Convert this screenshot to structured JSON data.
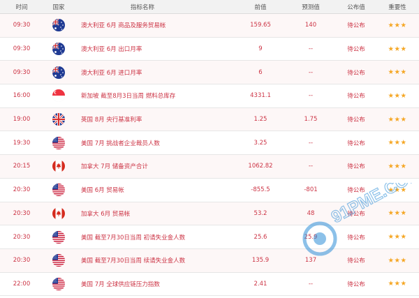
{
  "table": {
    "headers": {
      "time": "时间",
      "country": "国家",
      "indicator": "指标名称",
      "previous": "前值",
      "forecast": "预测值",
      "actual": "公布值",
      "importance": "重要性"
    },
    "rows": [
      {
        "time": "09:30",
        "flag": "australia-flag-icon",
        "indicator": "澳大利亚 6月 商品及服务贸易帐",
        "previous": "159.65",
        "forecast": "140",
        "actual": "待公布",
        "stars": "★★★"
      },
      {
        "time": "09:30",
        "flag": "australia-flag-icon",
        "indicator": "澳大利亚 6月 出口月率",
        "previous": "9",
        "forecast": "--",
        "actual": "待公布",
        "stars": "★★★"
      },
      {
        "time": "09:30",
        "flag": "australia-flag-icon",
        "indicator": "澳大利亚 6月 进口月率",
        "previous": "6",
        "forecast": "--",
        "actual": "待公布",
        "stars": "★★★"
      },
      {
        "time": "16:00",
        "flag": "singapore-flag-icon",
        "indicator": "新加坡 截至8月3日当周 燃料总库存",
        "previous": "4331.1",
        "forecast": "--",
        "actual": "待公布",
        "stars": "★★★"
      },
      {
        "time": "19:00",
        "flag": "uk-flag-icon",
        "indicator": "英国 8月 央行基准利率",
        "previous": "1.25",
        "forecast": "1.75",
        "actual": "待公布",
        "stars": "★★★"
      },
      {
        "time": "19:30",
        "flag": "us-flag-icon",
        "indicator": "美国 7月 挑战者企业裁员人数",
        "previous": "3.25",
        "forecast": "--",
        "actual": "待公布",
        "stars": "★★★"
      },
      {
        "time": "20:15",
        "flag": "canada-flag-icon",
        "indicator": "加拿大 7月 储备资产合计",
        "previous": "1062.82",
        "forecast": "--",
        "actual": "待公布",
        "stars": "★★★"
      },
      {
        "time": "20:30",
        "flag": "us-flag-icon",
        "indicator": "美国 6月 贸易帐",
        "previous": "-855.5",
        "forecast": "-801",
        "actual": "待公布",
        "stars": "★★★"
      },
      {
        "time": "20:30",
        "flag": "canada-flag-icon",
        "indicator": "加拿大 6月 贸易帐",
        "previous": "53.2",
        "forecast": "48",
        "actual": "待公布",
        "stars": "★★★"
      },
      {
        "time": "20:30",
        "flag": "us-flag-icon",
        "indicator": "美国 截至7月30日当周 初请失业金人数",
        "previous": "25.6",
        "forecast": "25.9",
        "actual": "待公布",
        "stars": "★★★"
      },
      {
        "time": "20:30",
        "flag": "us-flag-icon",
        "indicator": "美国 截至7月30日当周 续请失业金人数",
        "previous": "135.9",
        "forecast": "137",
        "actual": "待公布",
        "stars": "★★★"
      },
      {
        "time": "22:00",
        "flag": "us-flag-icon",
        "indicator": "美国 7月 全球供应链压力指数",
        "previous": "2.41",
        "forecast": "--",
        "actual": "待公布",
        "stars": "★★★"
      }
    ]
  },
  "colors": {
    "text_red": "#cc3344",
    "star_orange": "#f5a623",
    "header_bg": "#f2f2f2",
    "watermark_blue": "#2f8fd8"
  },
  "watermark": {
    "icon": "91pme-watermark-logo-icon",
    "text": "91PME.COM"
  }
}
